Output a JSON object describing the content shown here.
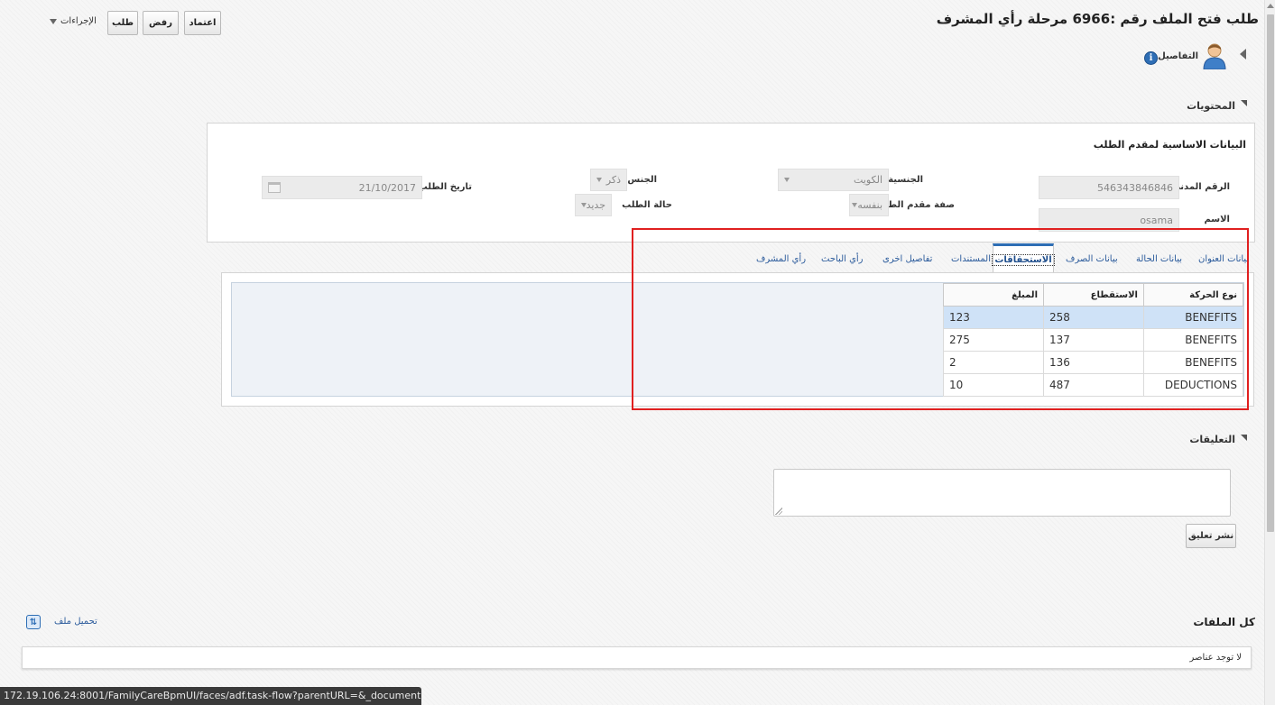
{
  "header": {
    "title": "طلب فتح الملف رقم :6966 مرحلة رأي المشرف",
    "buttons": {
      "approve": "اعتماد",
      "reject": "رفض",
      "request": "طلب",
      "actions": "الإجراءات"
    }
  },
  "details": {
    "label": "التفاصيل"
  },
  "contents": {
    "section_label": "المحتويات",
    "panel_title": "البيانات الاساسية لمقدم الطلب",
    "fields": {
      "civil_id": {
        "label": "الرقم المدني",
        "value": "546343846846"
      },
      "name": {
        "label": "الاسم",
        "value": "osama"
      },
      "nationality": {
        "label": "الجنسية",
        "value": "الكويت"
      },
      "applicant_type": {
        "label": "صفة مقدم الطلب",
        "value": "بنفسه"
      },
      "gender": {
        "label": "الجنس",
        "value": "ذكر"
      },
      "request_status": {
        "label": "حالة الطلب",
        "value": "جديد"
      },
      "request_date": {
        "label": "تاريخ الطلب",
        "value": "21/10/2017"
      }
    }
  },
  "tabs": [
    {
      "label": "بيانات العنوان"
    },
    {
      "label": "بيانات الحالة"
    },
    {
      "label": "بيانات الصرف"
    },
    {
      "label": "الاستحقاقات"
    },
    {
      "label": "المستندات"
    },
    {
      "label": "تفاصيل اخرى"
    },
    {
      "label": "رأي الباحث"
    },
    {
      "label": "رأي المشرف"
    }
  ],
  "grid": {
    "columns": [
      "نوع الحركة",
      "الاستقطاع",
      "المبلغ"
    ],
    "rows": [
      {
        "type": "BENEFITS",
        "deduction": "258",
        "amount": "123"
      },
      {
        "type": "BENEFITS",
        "deduction": "137",
        "amount": "275"
      },
      {
        "type": "BENEFITS",
        "deduction": "136",
        "amount": "2"
      },
      {
        "type": "DEDUCTIONS",
        "deduction": "487",
        "amount": "10"
      }
    ]
  },
  "comments": {
    "section_label": "التعليقات",
    "post_button": "نشر تعليق"
  },
  "files": {
    "title": "كل الملفات",
    "upload_link": "تحميل ملف",
    "empty_text": "لا توجد عناصر"
  },
  "status_url": "172.19.106.24:8001/FamilyCareBpmUI/faces/adf.task-flow?parentURL=&_document=...",
  "colors": {
    "accent": "#2e6eb5",
    "highlight_box": "#e02020",
    "selected_row": "#cfe2f7",
    "link": "#2a5a9b"
  }
}
